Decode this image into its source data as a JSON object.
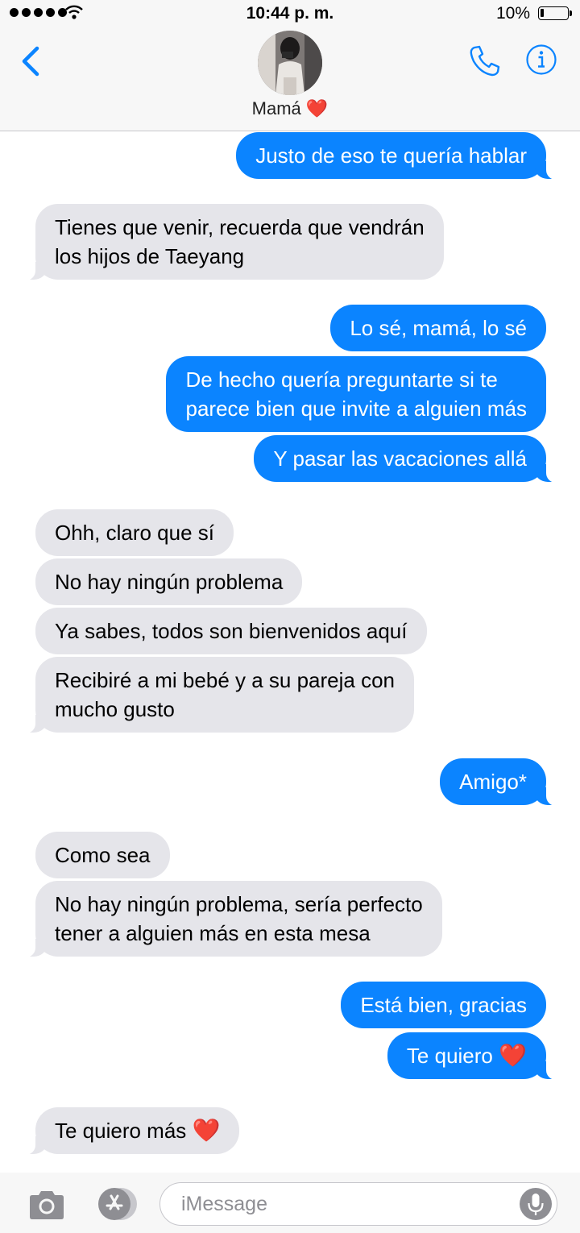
{
  "status_bar": {
    "time": "10:44 p. m.",
    "battery": "10%"
  },
  "header": {
    "contact_name": "Mamá",
    "contact_emoji": "❤️"
  },
  "messages": [
    {
      "side": "out",
      "lines": [
        "Justo de eso te quería hablar"
      ]
    },
    {
      "side": "in",
      "lines": [
        "Tienes que venir, recuerda que vendrán",
        "los hijos de Taeyang"
      ]
    },
    {
      "side": "out",
      "lines": [
        "Lo sé, mamá, lo sé"
      ]
    },
    {
      "side": "out",
      "lines": [
        "De hecho quería preguntarte si te",
        "parece bien que invite a alguien más"
      ]
    },
    {
      "side": "out",
      "lines": [
        "Y pasar las vacaciones allá"
      ]
    },
    {
      "side": "in",
      "lines": [
        "Ohh, claro que sí"
      ]
    },
    {
      "side": "in",
      "lines": [
        "No hay ningún problema"
      ]
    },
    {
      "side": "in",
      "lines": [
        "Ya sabes, todos son bienvenidos aquí"
      ]
    },
    {
      "side": "in",
      "lines": [
        "Recibiré a mi bebé y a su pareja con",
        "mucho gusto"
      ]
    },
    {
      "side": "out",
      "lines": [
        "Amigo*"
      ]
    },
    {
      "side": "in",
      "lines": [
        "Como sea"
      ]
    },
    {
      "side": "in",
      "lines": [
        "No hay ningún problema, sería perfecto",
        "tener a alguien más en esta mesa"
      ]
    },
    {
      "side": "out",
      "lines": [
        "Está bien, gracias"
      ]
    },
    {
      "side": "out",
      "lines": [
        "Te quiero"
      ],
      "emoji": "❤️"
    },
    {
      "side": "in",
      "lines": [
        "Te quiero más"
      ],
      "emoji": "❤️"
    }
  ],
  "input": {
    "placeholder": "iMessage"
  },
  "colors": {
    "outgoing_bubble": "#0b84ff",
    "incoming_bubble": "#e5e5ea",
    "accent": "#0b84ff"
  },
  "icons": [
    "back-chevron-icon",
    "phone-icon",
    "info-icon",
    "camera-icon",
    "app-store-icon",
    "microphone-icon"
  ]
}
